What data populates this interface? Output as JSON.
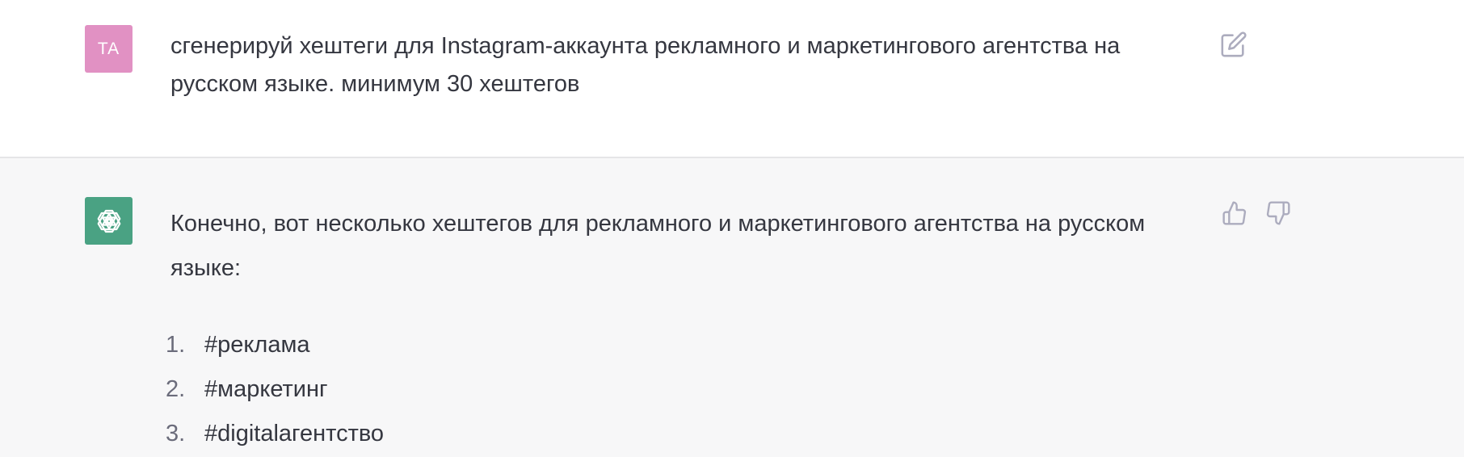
{
  "user_message": {
    "avatar_initials": "TA",
    "text": "сгенерируй хештеги для Instagram-аккаунта рекламного и маркетингового агентства на русском языке. минимум 30 хештегов",
    "edit_icon": "edit-icon"
  },
  "assistant_message": {
    "avatar_icon": "openai-logo-icon",
    "intro": "Конечно, вот несколько хештегов для рекламного и маркетингового агентства на русском языке:",
    "hashtags": [
      {
        "num": "1.",
        "text": "#реклама"
      },
      {
        "num": "2.",
        "text": "#маркетинг"
      },
      {
        "num": "3.",
        "text": "#digitalагентство"
      }
    ],
    "feedback_icons": [
      "thumbs-up-icon",
      "thumbs-down-icon"
    ]
  },
  "colors": {
    "user_avatar_bg": "#e191c3",
    "bot_avatar_bg": "#4aa283",
    "assistant_bg": "#f7f7f8",
    "text": "#353740"
  }
}
